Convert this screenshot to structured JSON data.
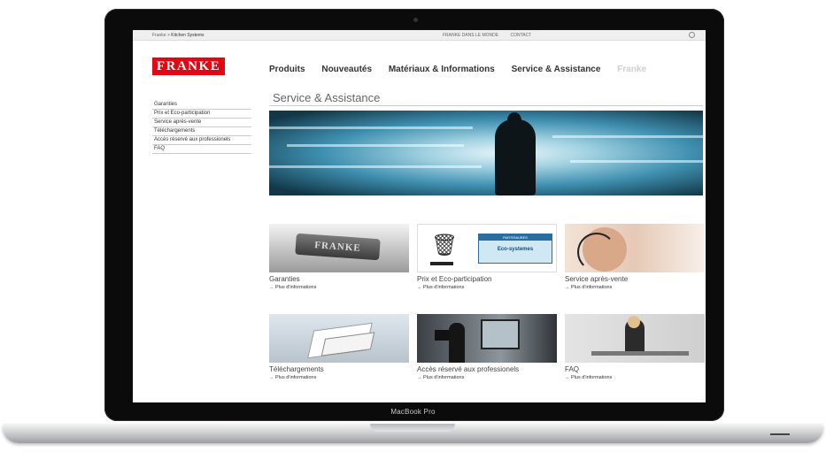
{
  "device": {
    "model_label": "MacBook Pro"
  },
  "topbar": {
    "breadcrumb_home": "Franke",
    "breadcrumb_sep": ">",
    "breadcrumb_current": "Kitchen Systems",
    "links": [
      "FRANKE DANS LE MONDE",
      "CONTACT"
    ]
  },
  "logo": {
    "text": "FRANKE",
    "color": "#e30613"
  },
  "main_nav": {
    "items": [
      "Produits",
      "Nouveautés",
      "Matériaux & Informations",
      "Service & Assistance"
    ],
    "dim_item": "Franke"
  },
  "page": {
    "title": "Service & Assistance"
  },
  "sidebar": {
    "items": [
      "Garanties",
      "Prix et Eco-participation",
      "Service après-vente",
      "Téléchargements",
      "Accès réservé aux professionels",
      "FAQ"
    ]
  },
  "tiles": [
    {
      "title": "Garanties",
      "link": "Plus d'informations",
      "badge_text": "FRANKE"
    },
    {
      "title": "Prix et Eco-participation",
      "link": "Plus d'informations",
      "badge_header": "PARTENAIRES",
      "badge_text": "Eco-systemes"
    },
    {
      "title": "Service après-vente",
      "link": "Plus d'informations"
    },
    {
      "title": "Téléchargements",
      "link": "Plus d'informations"
    },
    {
      "title": "Accès réservé aux professionels",
      "link": "Plus d'informations"
    },
    {
      "title": "FAQ",
      "link": "Plus d'informations"
    }
  ],
  "colors": {
    "brand_red": "#e30613",
    "hero_blue": "#3f8fb0"
  }
}
